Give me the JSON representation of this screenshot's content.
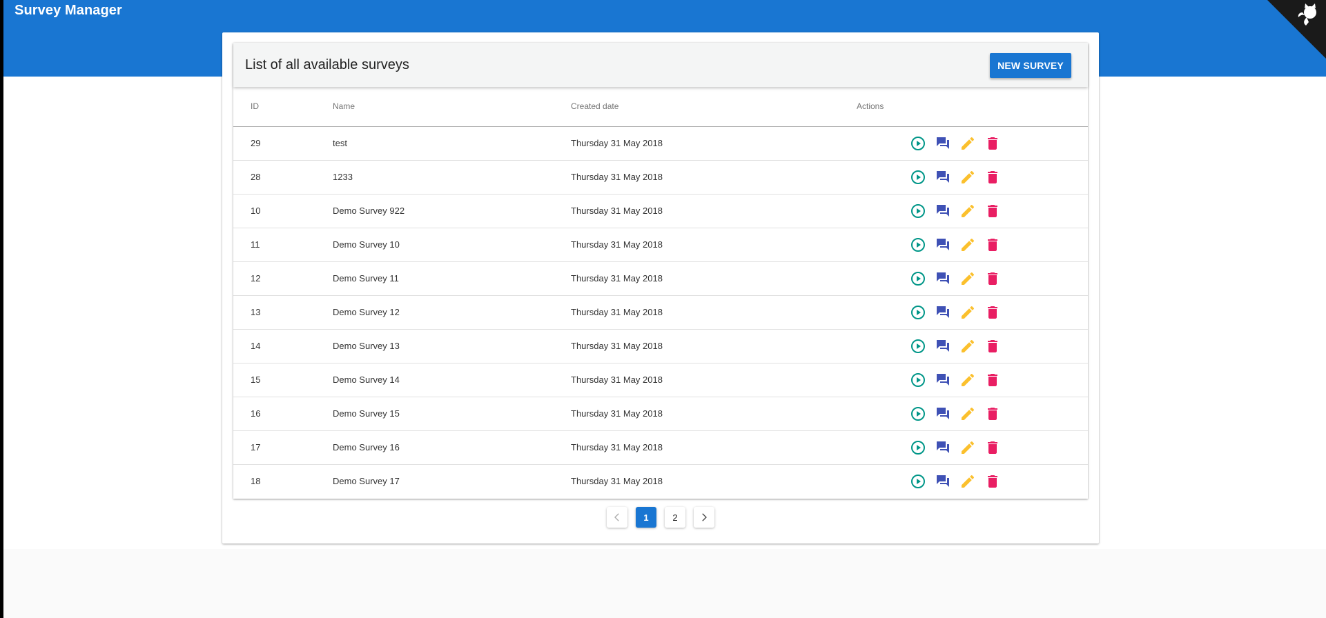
{
  "app": {
    "title": "Survey Manager"
  },
  "colors": {
    "primary": "#1976d2",
    "play": "#009688",
    "responses": "#3f51b5",
    "edit": "#fbc02d",
    "delete": "#e91e63"
  },
  "icons": {
    "corner": "github-octocat-icon",
    "play": "play-circle-icon",
    "responses": "forum-icon",
    "edit": "pencil-icon",
    "delete": "trash-icon",
    "prev": "chevron-left-icon",
    "next": "chevron-right-icon"
  },
  "panel": {
    "title": "List of all available surveys",
    "new_button": "NEW SURVEY"
  },
  "table": {
    "columns": [
      "ID",
      "Name",
      "Created date",
      "Actions"
    ],
    "rows": [
      {
        "id": "29",
        "name": "test",
        "date": "Thursday 31 May 2018"
      },
      {
        "id": "28",
        "name": "1233",
        "date": "Thursday 31 May 2018"
      },
      {
        "id": "10",
        "name": "Demo Survey 922",
        "date": "Thursday 31 May 2018"
      },
      {
        "id": "11",
        "name": "Demo Survey 10",
        "date": "Thursday 31 May 2018"
      },
      {
        "id": "12",
        "name": "Demo Survey 11",
        "date": "Thursday 31 May 2018"
      },
      {
        "id": "13",
        "name": "Demo Survey 12",
        "date": "Thursday 31 May 2018"
      },
      {
        "id": "14",
        "name": "Demo Survey 13",
        "date": "Thursday 31 May 2018"
      },
      {
        "id": "15",
        "name": "Demo Survey 14",
        "date": "Thursday 31 May 2018"
      },
      {
        "id": "16",
        "name": "Demo Survey 15",
        "date": "Thursday 31 May 2018"
      },
      {
        "id": "17",
        "name": "Demo Survey 16",
        "date": "Thursday 31 May 2018"
      },
      {
        "id": "18",
        "name": "Demo Survey 17",
        "date": "Thursday 31 May 2018"
      }
    ]
  },
  "pagination": {
    "pages": [
      "1",
      "2"
    ],
    "current": "1"
  }
}
